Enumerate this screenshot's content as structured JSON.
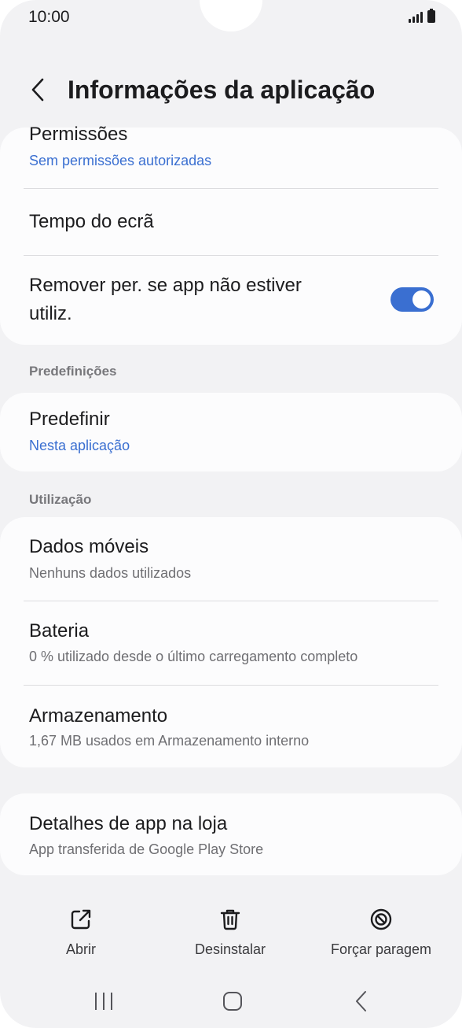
{
  "status_bar": {
    "time": "10:00"
  },
  "header": {
    "title": "Informações da aplicação"
  },
  "permissions_card": {
    "permissions": {
      "title": "Permissões",
      "subtitle": "Sem permissões autorizadas"
    },
    "screen_time": {
      "title": "Tempo do ecrã"
    },
    "remove_permissions": {
      "title_line1": "Remover per. se app não estiver",
      "title_line2": "utiliz.",
      "enabled": true
    }
  },
  "defaults_section": {
    "label": "Predefinições",
    "set_default": {
      "title": "Predefinir",
      "subtitle": "Nesta aplicação"
    }
  },
  "usage_section": {
    "label": "Utilização",
    "mobile_data": {
      "title": "Dados móveis",
      "subtitle": "Nenhuns dados utilizados"
    },
    "battery": {
      "title": "Bateria",
      "subtitle": "0 % utilizado desde o último carregamento completo"
    },
    "storage": {
      "title": "Armazenamento",
      "subtitle": "1,67 MB usados em Armazenamento interno"
    }
  },
  "store_card": {
    "details": {
      "title": "Detalhes de app na loja",
      "subtitle": "App transferida de Google Play Store"
    }
  },
  "actions": {
    "open": {
      "label": "Abrir",
      "icon": "open-external-icon"
    },
    "uninstall": {
      "label": "Desinstalar",
      "icon": "trash-icon"
    },
    "force_stop": {
      "label": "Forçar paragem",
      "icon": "block-icon"
    }
  },
  "colors": {
    "accent": "#3a6fd1",
    "background": "#f2f2f4",
    "card": "#fcfcfd"
  }
}
